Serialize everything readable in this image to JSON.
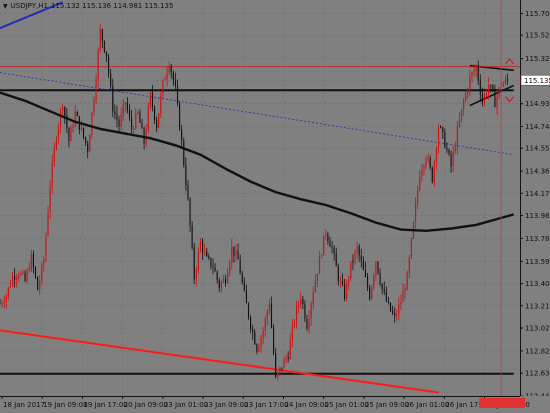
{
  "header": {
    "symbol": "USDJPY,H1",
    "ohlc": "115.132 115.136 114.981 115.135"
  },
  "colors": {
    "background": "#808080",
    "grid": "#6e6e6e",
    "candle": "#111111",
    "bull_wick": "#cc1111",
    "moving_average": "#111111",
    "trend_blue": "#1f2fb0",
    "trend_red": "#ff1a1a",
    "price_tag_bg": "#ffffff",
    "price_tag_border": "#d01818",
    "time_marker": "#e03030",
    "time_marker_text": "#ffffff"
  },
  "chart_data": {
    "type": "candlestick",
    "y_axis": {
      "min": 112.44,
      "max": 115.82,
      "ticks": [
        "115.705",
        "115.520",
        "115.320",
        "115.135",
        "114.935",
        "114.740",
        "114.555",
        "114.360",
        "114.170",
        "113.980",
        "113.785",
        "113.590",
        "113.400",
        "113.210",
        "113.020",
        "112.825",
        "112.635",
        "112.440"
      ]
    },
    "x_axis": {
      "labels": [
        "18 Jan 2017",
        "19 Jan 09:00",
        "19 Jan 17:00",
        "20 Jan 09:00",
        "23 Jan 01:00",
        "23 Jan 09:00",
        "23 Jan 17:00",
        "24 Jan 09:00",
        "25 Jan 01:00",
        "25 Jan 09:00",
        "26 Jan 01:00",
        "26 Jan 17:00",
        "27 Jan 01:00"
      ]
    },
    "current_price": "115.135",
    "current_time_label": "",
    "close_path": [
      [
        0,
        113.23
      ],
      [
        3,
        113.3
      ],
      [
        6,
        113.46
      ],
      [
        9,
        113.5
      ],
      [
        12,
        113.42
      ],
      [
        15,
        113.62
      ],
      [
        18,
        113.35
      ],
      [
        21,
        113.6
      ],
      [
        24,
        114.25
      ],
      [
        27,
        114.68
      ],
      [
        30,
        114.95
      ],
      [
        33,
        114.62
      ],
      [
        36,
        114.85
      ],
      [
        39,
        114.7
      ],
      [
        42,
        114.55
      ],
      [
        45,
        115.0
      ],
      [
        48,
        115.55
      ],
      [
        51,
        115.35
      ],
      [
        54,
        114.9
      ],
      [
        57,
        114.75
      ],
      [
        60,
        114.95
      ],
      [
        63,
        114.72
      ],
      [
        66,
        114.85
      ],
      [
        69,
        114.6
      ],
      [
        72,
        115.0
      ],
      [
        75,
        114.75
      ],
      [
        78,
        115.1
      ],
      [
        81,
        115.3
      ],
      [
        84,
        115.05
      ],
      [
        87,
        114.6
      ],
      [
        90,
        114.1
      ],
      [
        93,
        113.45
      ],
      [
        96,
        113.75
      ],
      [
        99,
        113.6
      ],
      [
        102,
        113.55
      ],
      [
        105,
        113.38
      ],
      [
        108,
        113.45
      ],
      [
        111,
        113.7
      ],
      [
        114,
        113.6
      ],
      [
        117,
        113.3
      ],
      [
        120,
        113.05
      ],
      [
        123,
        112.85
      ],
      [
        126,
        113.0
      ],
      [
        129,
        113.25
      ],
      [
        132,
        112.58
      ],
      [
        135,
        112.7
      ],
      [
        138,
        112.8
      ],
      [
        141,
        113.1
      ],
      [
        144,
        113.3
      ],
      [
        147,
        113.05
      ],
      [
        150,
        113.35
      ],
      [
        153,
        113.6
      ],
      [
        156,
        113.85
      ],
      [
        159,
        113.7
      ],
      [
        162,
        113.45
      ],
      [
        165,
        113.3
      ],
      [
        168,
        113.55
      ],
      [
        171,
        113.7
      ],
      [
        174,
        113.5
      ],
      [
        177,
        113.3
      ],
      [
        180,
        113.6
      ],
      [
        183,
        113.35
      ],
      [
        186,
        113.2
      ],
      [
        189,
        113.1
      ],
      [
        192,
        113.25
      ],
      [
        195,
        113.45
      ],
      [
        198,
        113.9
      ],
      [
        201,
        114.35
      ],
      [
        204,
        114.5
      ],
      [
        207,
        114.3
      ],
      [
        210,
        114.75
      ],
      [
        213,
        114.6
      ],
      [
        216,
        114.4
      ],
      [
        219,
        114.7
      ],
      [
        222,
        114.95
      ],
      [
        225,
        115.15
      ],
      [
        228,
        115.25
      ],
      [
        231,
        114.95
      ],
      [
        234,
        115.1
      ],
      [
        237,
        114.95
      ],
      [
        240,
        115.1
      ],
      [
        243,
        115.13
      ]
    ],
    "moving_average": [
      [
        0,
        115.03
      ],
      [
        12,
        114.96
      ],
      [
        24,
        114.87
      ],
      [
        36,
        114.78
      ],
      [
        48,
        114.72
      ],
      [
        60,
        114.68
      ],
      [
        72,
        114.64
      ],
      [
        84,
        114.58
      ],
      [
        96,
        114.5
      ],
      [
        108,
        114.38
      ],
      [
        120,
        114.27
      ],
      [
        132,
        114.18
      ],
      [
        144,
        114.12
      ],
      [
        156,
        114.07
      ],
      [
        168,
        114.0
      ],
      [
        180,
        113.92
      ],
      [
        192,
        113.86
      ],
      [
        204,
        113.85
      ],
      [
        216,
        113.87
      ],
      [
        228,
        113.9
      ],
      [
        240,
        113.96
      ],
      [
        246,
        113.99
      ]
    ],
    "lines": [
      {
        "name": "support",
        "from": [
          0,
          112.63
        ],
        "to": [
          246,
          112.63
        ]
      },
      {
        "name": "resistance",
        "from": [
          0,
          115.05
        ],
        "to": [
          246,
          115.05
        ]
      },
      {
        "name": "upper-channel",
        "from": [
          225,
          115.26
        ],
        "to": [
          246,
          115.22
        ]
      },
      {
        "name": "lower-channel",
        "from": [
          225,
          114.92
        ],
        "to": [
          246,
          115.09
        ]
      },
      {
        "name": "blue-trend",
        "from": [
          0,
          115.58
        ],
        "to": [
          30,
          115.8
        ]
      },
      {
        "name": "red-trend",
        "from": [
          0,
          113.0
        ],
        "to": [
          210,
          112.47
        ]
      },
      {
        "name": "dotted-trend",
        "from": [
          0,
          115.2
        ],
        "to": [
          246,
          114.5
        ]
      }
    ],
    "highlight_level": 115.25,
    "time_marker_bar": 240,
    "total_bars": 250
  }
}
